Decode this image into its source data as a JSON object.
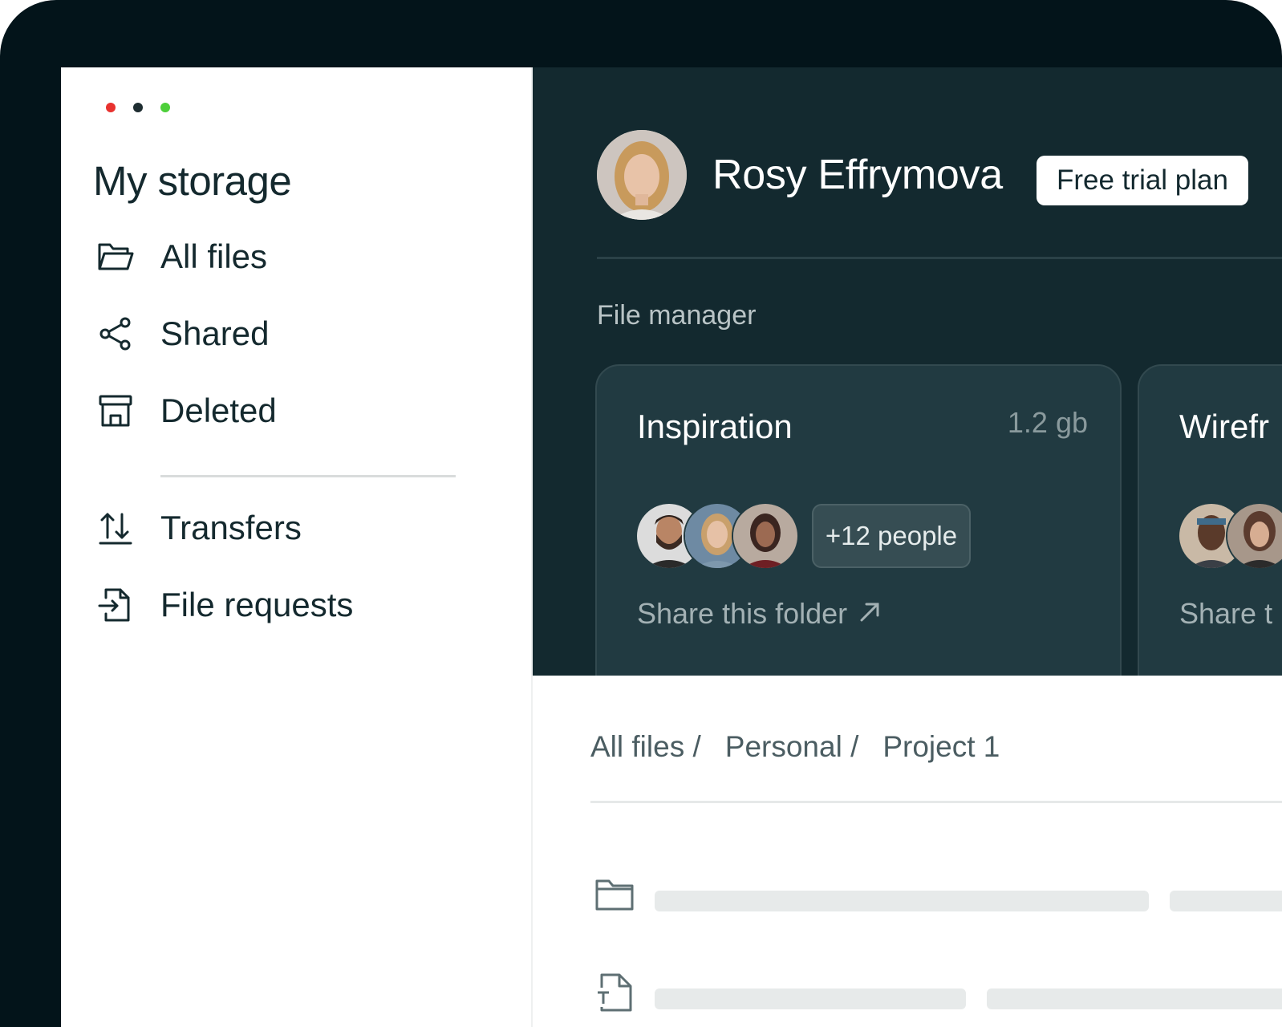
{
  "window": {
    "controls": [
      "#e8322f",
      "#1e2d31",
      "#4dcf3a"
    ]
  },
  "sidebar": {
    "title": "My storage",
    "items": [
      {
        "label": "All files",
        "icon": "folder-open-icon"
      },
      {
        "label": "Shared",
        "icon": "share-icon"
      },
      {
        "label": "Deleted",
        "icon": "archive-icon"
      },
      {
        "label": "Transfers",
        "icon": "transfer-arrows-icon"
      },
      {
        "label": "File requests",
        "icon": "file-import-icon"
      }
    ]
  },
  "user": {
    "name": "Rosy Effrymova",
    "plan": "Free trial plan"
  },
  "file_manager": {
    "label": "File manager",
    "cards": [
      {
        "title": "Inspiration",
        "size": "1.2 gb",
        "people": "+12 people",
        "share": "Share this folder",
        "share_icon": "arrow-up-right-icon"
      },
      {
        "title": "Wirefr",
        "share": "Share t"
      }
    ]
  },
  "breadcrumb": [
    "All files /",
    "Personal /",
    "Project 1"
  ],
  "files": [
    {
      "icon": "folder-icon"
    },
    {
      "icon": "text-file-icon"
    }
  ],
  "colors": {
    "frame": "#03141a",
    "panel": "#13292f",
    "card": "#213a41",
    "text_dark": "#14292e"
  }
}
